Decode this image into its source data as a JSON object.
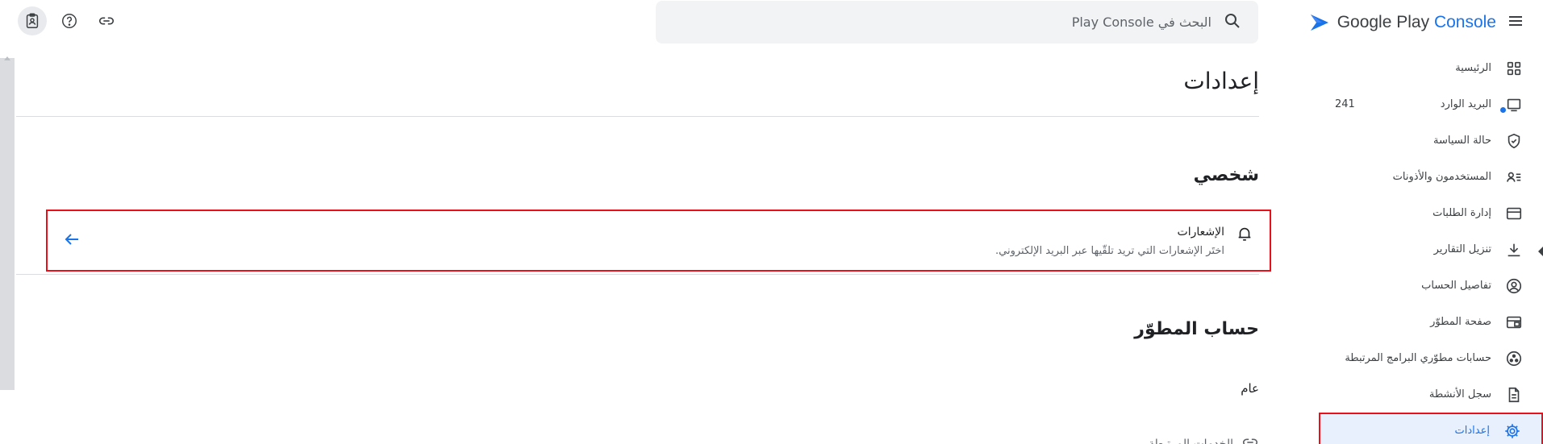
{
  "toolbar": {
    "icons": [
      "clipboard-user-icon",
      "help-icon",
      "link-icon"
    ]
  },
  "search": {
    "placeholder": "البحث في Play Console"
  },
  "brand": {
    "name": "Google Play ",
    "product": "Console"
  },
  "sidebar": {
    "items": [
      {
        "label": "الرئيسية",
        "icon": "dashboard-icon"
      },
      {
        "label": "البريد الوارد",
        "icon": "inbox-icon",
        "count": "241",
        "has_dot": true
      },
      {
        "label": "حالة السياسة",
        "icon": "shield-check-icon"
      },
      {
        "label": "المستخدمون والأذونات",
        "icon": "users-permissions-icon"
      },
      {
        "label": "إدارة الطلبات",
        "icon": "credit-card-icon"
      },
      {
        "label": "تنزيل التقارير",
        "icon": "download-icon"
      },
      {
        "label": "تفاصيل الحساب",
        "icon": "account-circle-icon"
      },
      {
        "label": "صفحة المطوّر",
        "icon": "developer-page-icon"
      },
      {
        "label": "حسابات مطوّري البرامج المرتبطة",
        "icon": "linked-accounts-icon"
      },
      {
        "label": "سجل الأنشطة",
        "icon": "document-icon"
      },
      {
        "label": "إعدادات",
        "icon": "gear-icon",
        "selected": true
      }
    ]
  },
  "main": {
    "title": "إعدادات",
    "personal": {
      "heading": "شخصي",
      "notifications": {
        "title": "الإشعارات",
        "description": "اختَر الإشعارات التي تريد تلقّيها عبر البريد الإلكتروني."
      }
    },
    "developer_account": {
      "heading": "حساب المطوّر",
      "sub_label": "عام",
      "cut_item": "الخدمات المرتبطة"
    }
  },
  "colors": {
    "accent": "#1a73e8",
    "highlight_border": "#e8101a",
    "selected_bg": "#e8f0fe"
  }
}
